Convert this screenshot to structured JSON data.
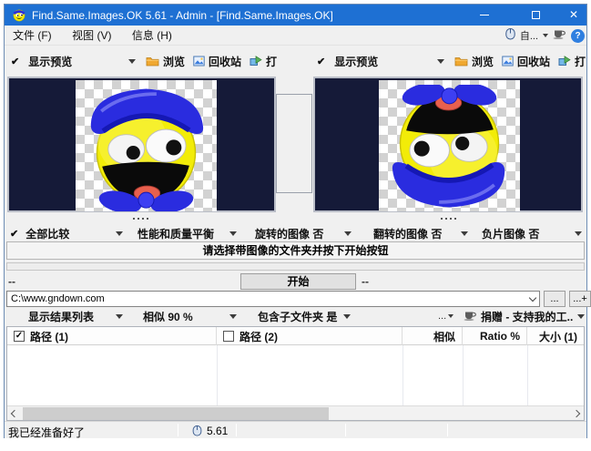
{
  "window": {
    "title": "Find.Same.Images.OK 5.61 - Admin - [Find.Same.Images.OK]",
    "close_glyph": "✕"
  },
  "menubar": {
    "items": [
      {
        "label": "文件 (F)"
      },
      {
        "label": "视图 (V)"
      },
      {
        "label": "信息 (H)"
      }
    ],
    "auto_label": "自...",
    "help_glyph": "?"
  },
  "panel_left": {
    "check_glyph": "✔",
    "preview_label": "显示预览",
    "browse_label": "浏览",
    "recycle_label": "回收站",
    "open_label": "打"
  },
  "panel_right": {
    "check_glyph": "✔",
    "preview_label": "显示预览",
    "browse_label": "浏览",
    "recycle_label": "回收站",
    "open_label": "打"
  },
  "compare_row": {
    "check_glyph": "✔",
    "items": [
      {
        "label": "全部比较"
      },
      {
        "label": "性能和质量平衡"
      },
      {
        "label": "旋转的图像 否"
      },
      {
        "label": "翻转的图像 否"
      },
      {
        "label": "负片图像 否"
      }
    ]
  },
  "action": {
    "instruction": "请选择带图像的文件夹并按下开始按钮",
    "left_value": "--",
    "start_label": "开始",
    "right_value": "--"
  },
  "path_row": {
    "value": "C:\\www.gndown.com",
    "browse_label": "...",
    "browse_add_label": "...+"
  },
  "options_row": {
    "result_list_label": "显示结果列表",
    "similarity_label": "相似 90 %",
    "subfolders_label": "包含子文件夹 是",
    "more_label": "...",
    "donate_label": "捐赠 - 支持我的工..."
  },
  "table": {
    "path1_check": "✓",
    "col_path1": "路径 (1)",
    "col_path2": "路径 (2)",
    "col_similar": "相似",
    "col_ratio": "Ratio %",
    "col_size": "大小 (1)",
    "rows": []
  },
  "statusbar": {
    "message": "我已经准备好了",
    "version": "5.61"
  }
}
